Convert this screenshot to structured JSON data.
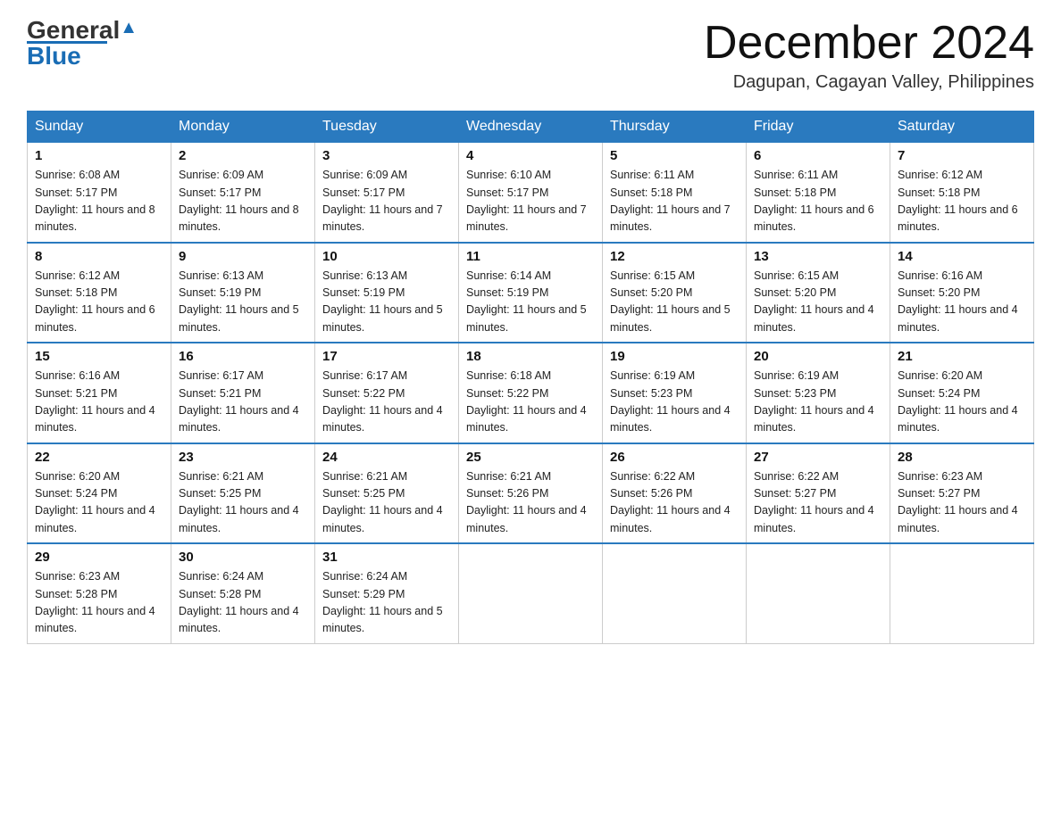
{
  "header": {
    "logo_general": "General",
    "logo_blue": "Blue",
    "month_title": "December 2024",
    "location": "Dagupan, Cagayan Valley, Philippines"
  },
  "weekdays": [
    "Sunday",
    "Monday",
    "Tuesday",
    "Wednesday",
    "Thursday",
    "Friday",
    "Saturday"
  ],
  "weeks": [
    [
      {
        "day": "1",
        "sunrise": "6:08 AM",
        "sunset": "5:17 PM",
        "daylight": "11 hours and 8 minutes."
      },
      {
        "day": "2",
        "sunrise": "6:09 AM",
        "sunset": "5:17 PM",
        "daylight": "11 hours and 8 minutes."
      },
      {
        "day": "3",
        "sunrise": "6:09 AM",
        "sunset": "5:17 PM",
        "daylight": "11 hours and 7 minutes."
      },
      {
        "day": "4",
        "sunrise": "6:10 AM",
        "sunset": "5:17 PM",
        "daylight": "11 hours and 7 minutes."
      },
      {
        "day": "5",
        "sunrise": "6:11 AM",
        "sunset": "5:18 PM",
        "daylight": "11 hours and 7 minutes."
      },
      {
        "day": "6",
        "sunrise": "6:11 AM",
        "sunset": "5:18 PM",
        "daylight": "11 hours and 6 minutes."
      },
      {
        "day": "7",
        "sunrise": "6:12 AM",
        "sunset": "5:18 PM",
        "daylight": "11 hours and 6 minutes."
      }
    ],
    [
      {
        "day": "8",
        "sunrise": "6:12 AM",
        "sunset": "5:18 PM",
        "daylight": "11 hours and 6 minutes."
      },
      {
        "day": "9",
        "sunrise": "6:13 AM",
        "sunset": "5:19 PM",
        "daylight": "11 hours and 5 minutes."
      },
      {
        "day": "10",
        "sunrise": "6:13 AM",
        "sunset": "5:19 PM",
        "daylight": "11 hours and 5 minutes."
      },
      {
        "day": "11",
        "sunrise": "6:14 AM",
        "sunset": "5:19 PM",
        "daylight": "11 hours and 5 minutes."
      },
      {
        "day": "12",
        "sunrise": "6:15 AM",
        "sunset": "5:20 PM",
        "daylight": "11 hours and 5 minutes."
      },
      {
        "day": "13",
        "sunrise": "6:15 AM",
        "sunset": "5:20 PM",
        "daylight": "11 hours and 4 minutes."
      },
      {
        "day": "14",
        "sunrise": "6:16 AM",
        "sunset": "5:20 PM",
        "daylight": "11 hours and 4 minutes."
      }
    ],
    [
      {
        "day": "15",
        "sunrise": "6:16 AM",
        "sunset": "5:21 PM",
        "daylight": "11 hours and 4 minutes."
      },
      {
        "day": "16",
        "sunrise": "6:17 AM",
        "sunset": "5:21 PM",
        "daylight": "11 hours and 4 minutes."
      },
      {
        "day": "17",
        "sunrise": "6:17 AM",
        "sunset": "5:22 PM",
        "daylight": "11 hours and 4 minutes."
      },
      {
        "day": "18",
        "sunrise": "6:18 AM",
        "sunset": "5:22 PM",
        "daylight": "11 hours and 4 minutes."
      },
      {
        "day": "19",
        "sunrise": "6:19 AM",
        "sunset": "5:23 PM",
        "daylight": "11 hours and 4 minutes."
      },
      {
        "day": "20",
        "sunrise": "6:19 AM",
        "sunset": "5:23 PM",
        "daylight": "11 hours and 4 minutes."
      },
      {
        "day": "21",
        "sunrise": "6:20 AM",
        "sunset": "5:24 PM",
        "daylight": "11 hours and 4 minutes."
      }
    ],
    [
      {
        "day": "22",
        "sunrise": "6:20 AM",
        "sunset": "5:24 PM",
        "daylight": "11 hours and 4 minutes."
      },
      {
        "day": "23",
        "sunrise": "6:21 AM",
        "sunset": "5:25 PM",
        "daylight": "11 hours and 4 minutes."
      },
      {
        "day": "24",
        "sunrise": "6:21 AM",
        "sunset": "5:25 PM",
        "daylight": "11 hours and 4 minutes."
      },
      {
        "day": "25",
        "sunrise": "6:21 AM",
        "sunset": "5:26 PM",
        "daylight": "11 hours and 4 minutes."
      },
      {
        "day": "26",
        "sunrise": "6:22 AM",
        "sunset": "5:26 PM",
        "daylight": "11 hours and 4 minutes."
      },
      {
        "day": "27",
        "sunrise": "6:22 AM",
        "sunset": "5:27 PM",
        "daylight": "11 hours and 4 minutes."
      },
      {
        "day": "28",
        "sunrise": "6:23 AM",
        "sunset": "5:27 PM",
        "daylight": "11 hours and 4 minutes."
      }
    ],
    [
      {
        "day": "29",
        "sunrise": "6:23 AM",
        "sunset": "5:28 PM",
        "daylight": "11 hours and 4 minutes."
      },
      {
        "day": "30",
        "sunrise": "6:24 AM",
        "sunset": "5:28 PM",
        "daylight": "11 hours and 4 minutes."
      },
      {
        "day": "31",
        "sunrise": "6:24 AM",
        "sunset": "5:29 PM",
        "daylight": "11 hours and 5 minutes."
      },
      null,
      null,
      null,
      null
    ]
  ]
}
